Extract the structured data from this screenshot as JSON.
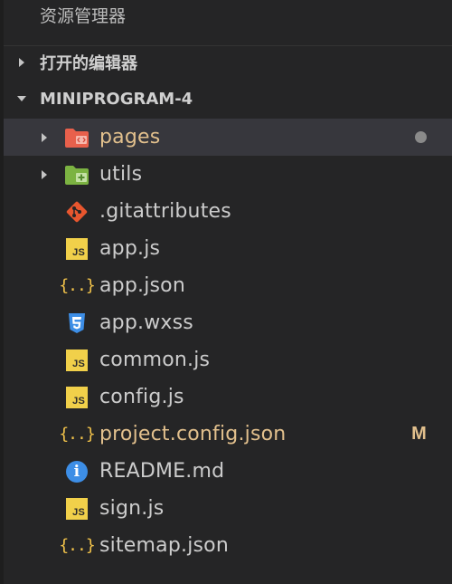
{
  "explorer": {
    "title": "资源管理器"
  },
  "sections": {
    "open_editors": {
      "label": "打开的编辑器",
      "expanded": false
    },
    "project": {
      "label": "MINIPROGRAM-4",
      "expanded": true
    }
  },
  "tree": [
    {
      "name": "pages",
      "kind": "folder",
      "icon": "folder-pages-icon",
      "color": "#e8604c",
      "status": "dot"
    },
    {
      "name": "utils",
      "kind": "folder",
      "icon": "folder-utils-icon",
      "color": "#7cb342"
    },
    {
      "name": ".gitattributes",
      "kind": "file",
      "icon": "git-icon",
      "color": "#e8562e"
    },
    {
      "name": "app.js",
      "kind": "file",
      "icon": "js-icon",
      "color": "#f1d04a"
    },
    {
      "name": "app.json",
      "kind": "file",
      "icon": "json-icon",
      "color": "#f1c24a"
    },
    {
      "name": "app.wxss",
      "kind": "file",
      "icon": "css-icon",
      "color": "#3d8ee6"
    },
    {
      "name": "common.js",
      "kind": "file",
      "icon": "js-icon",
      "color": "#f1d04a"
    },
    {
      "name": "config.js",
      "kind": "file",
      "icon": "js-icon",
      "color": "#f1d04a"
    },
    {
      "name": "project.config.json",
      "kind": "file",
      "icon": "json-icon",
      "color": "#f1c24a",
      "status": "M"
    },
    {
      "name": "README.md",
      "kind": "file",
      "icon": "info-icon",
      "color": "#3d8ee6"
    },
    {
      "name": "sign.js",
      "kind": "file",
      "icon": "js-icon",
      "color": "#f1d04a"
    },
    {
      "name": "sitemap.json",
      "kind": "file",
      "icon": "json-icon",
      "color": "#f1c24a"
    }
  ],
  "icons": {
    "js_text": "JS",
    "json_text": "{..}",
    "info_text": "i"
  },
  "colors": {
    "background": "#252526",
    "selected_row": "#37373d",
    "modified_text": "#e2c08d"
  }
}
